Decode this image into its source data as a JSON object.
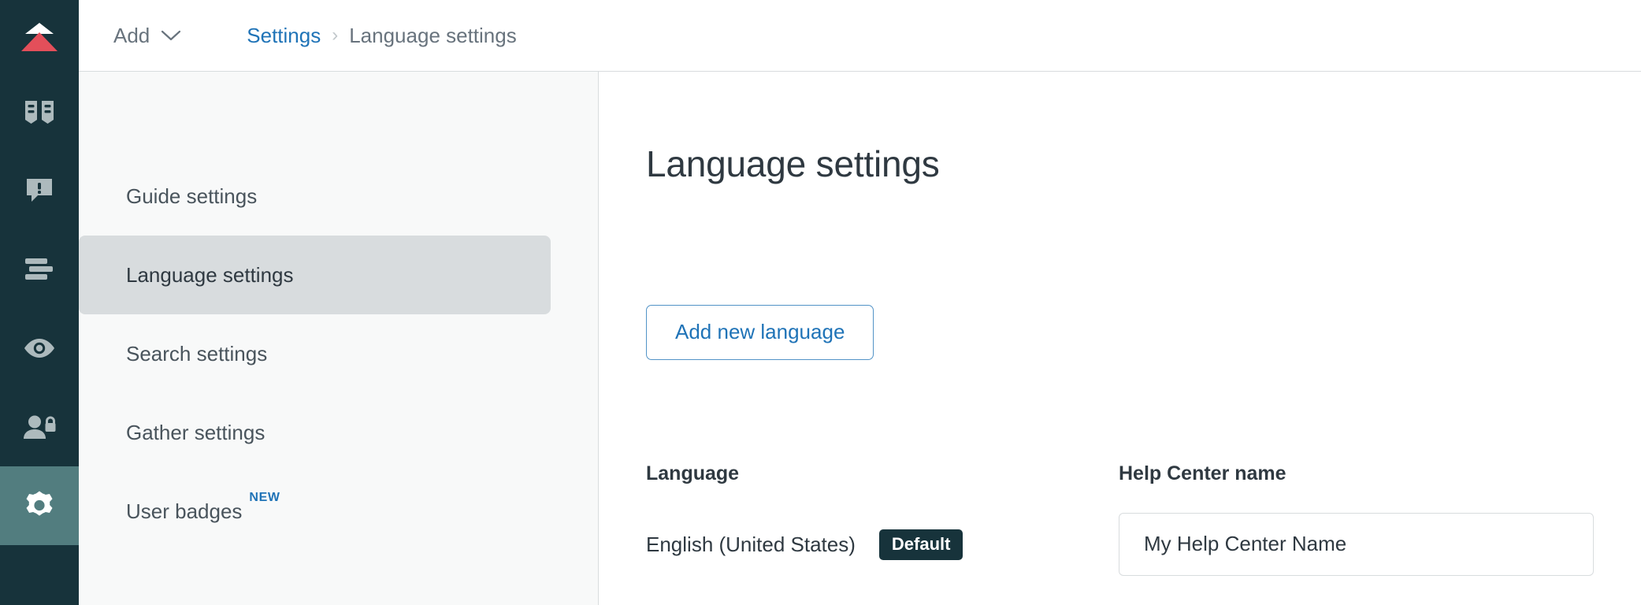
{
  "colors": {
    "rail_bg": "#17333b",
    "rail_active_bg": "#527d7f",
    "logo_red": "#e34f5a",
    "logo_white": "#ffffff",
    "accent_blue": "#1f73b7",
    "nav_active_bg": "#d8dcde",
    "panel_bg": "#f8f9f9",
    "border": "#d8dcde",
    "text_dark": "#2f3941",
    "text_muted": "#68737d",
    "badge_bg": "#17333b"
  },
  "rail": {
    "logo_name": "zendesk-guide-logo",
    "items": [
      {
        "name": "knowledge-base-icon",
        "label": "Knowledge base",
        "active": false
      },
      {
        "name": "community-icon",
        "label": "Community",
        "active": false
      },
      {
        "name": "content-blocks-icon",
        "label": "Content blocks",
        "active": false
      },
      {
        "name": "preview-icon",
        "label": "Preview",
        "active": false
      },
      {
        "name": "user-permissions-icon",
        "label": "User permissions",
        "active": false
      },
      {
        "name": "settings-gear-icon",
        "label": "Settings",
        "active": true
      }
    ]
  },
  "topbar": {
    "add_label": "Add",
    "add_chevron": "chevron-down-icon",
    "breadcrumb": {
      "parent": "Settings",
      "separator": "›",
      "current": "Language settings"
    }
  },
  "subnav": {
    "items": [
      {
        "label": "Guide settings",
        "active": false,
        "badge": ""
      },
      {
        "label": "Language settings",
        "active": true,
        "badge": ""
      },
      {
        "label": "Search settings",
        "active": false,
        "badge": ""
      },
      {
        "label": "Gather settings",
        "active": false,
        "badge": ""
      },
      {
        "label": "User badges",
        "active": false,
        "badge": "NEW"
      }
    ]
  },
  "content": {
    "title": "Language settings",
    "add_language_button": "Add new language",
    "language_section": {
      "label": "Language",
      "value": "English (United States)",
      "badge": "Default"
    },
    "help_center_section": {
      "label": "Help Center name",
      "value": "My Help Center Name",
      "placeholder": "My Help Center Name"
    }
  }
}
